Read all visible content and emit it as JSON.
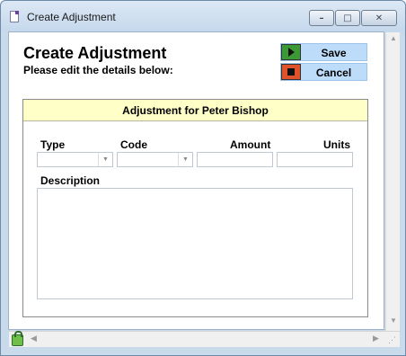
{
  "window": {
    "title": "Create Adjustment",
    "controls": {
      "minimize": "–",
      "maximize": "□",
      "close": "✕"
    }
  },
  "header": {
    "title": "Create Adjustment",
    "subtitle": "Please edit the details below:"
  },
  "actions": {
    "save_label": "Save",
    "cancel_label": "Cancel",
    "save_icon": "play-icon",
    "cancel_icon": "stop-icon",
    "save_color": "#3c9a36",
    "cancel_color": "#e0522a",
    "button_bg": "#bcdcfa"
  },
  "form": {
    "panel_title": "Adjustment for Peter Bishop",
    "panel_header_bg": "#ffffc8",
    "type_label": "Type",
    "code_label": "Code",
    "amount_label": "Amount",
    "units_label": "Units",
    "description_label": "Description",
    "type_value": "",
    "code_value": "",
    "amount_value": "",
    "units_value": "",
    "description_value": ""
  },
  "statusbar": {
    "lock_icon": "lock-icon"
  }
}
